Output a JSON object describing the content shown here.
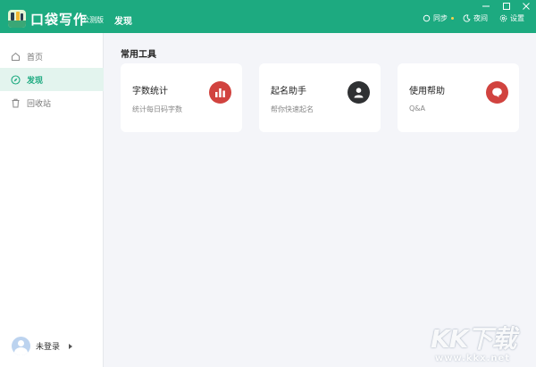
{
  "header": {
    "app_title": "口袋写作",
    "edition": "公测版",
    "nav_discover": "发现",
    "sync_label": "同步",
    "night_label": "夜间",
    "settings_label": "设置",
    "accent_color": "#1daa80"
  },
  "sidebar": {
    "items": [
      {
        "label": "首页",
        "icon": "home-icon"
      },
      {
        "label": "发现",
        "icon": "compass-icon"
      },
      {
        "label": "回收站",
        "icon": "trash-icon"
      }
    ],
    "user_label": "未登录"
  },
  "main": {
    "section_title": "常用工具",
    "cards": [
      {
        "title": "字数统计",
        "subtitle": "统计每日码字数",
        "icon": "bar-chart-icon",
        "icon_color": "#d1433f"
      },
      {
        "title": "起名助手",
        "subtitle": "帮你快速起名",
        "icon": "person-icon",
        "icon_color": "#2f3133"
      },
      {
        "title": "使用帮助",
        "subtitle": "Q&A",
        "icon": "chat-bubble-icon",
        "icon_color": "#d1433f"
      }
    ]
  },
  "watermark": {
    "text": "KK下载",
    "url": "www.kkx.net"
  }
}
